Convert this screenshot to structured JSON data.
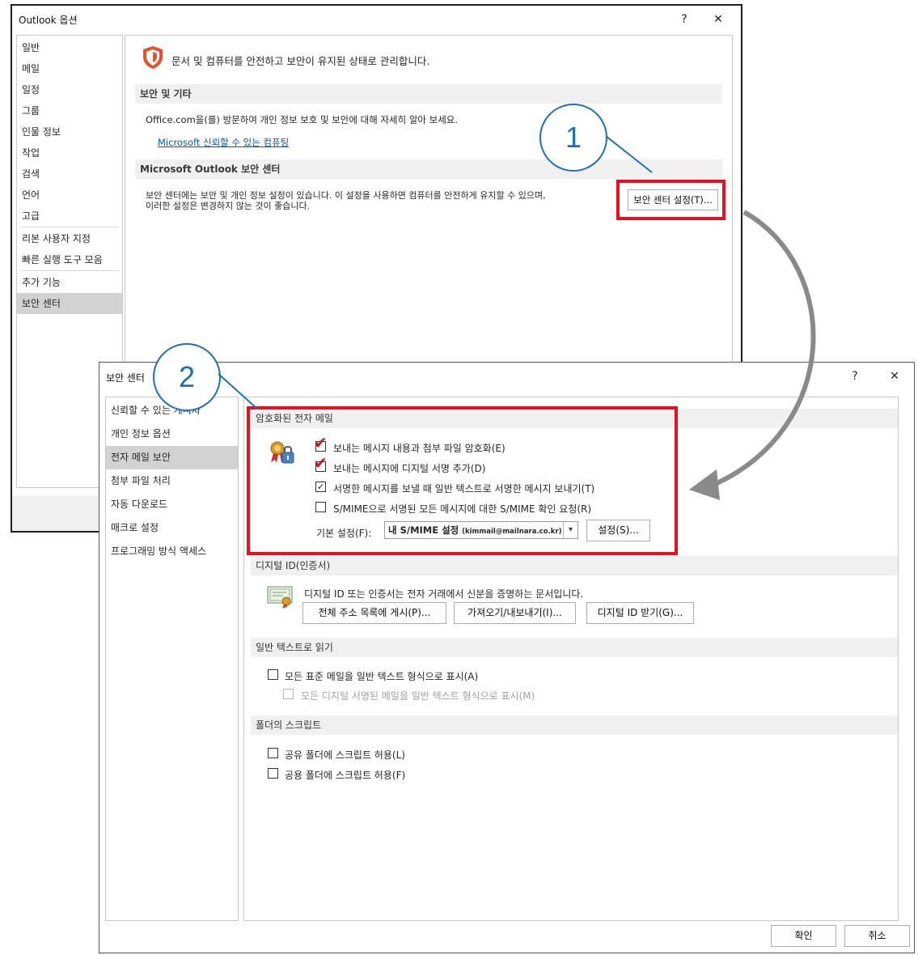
{
  "outlook_options": {
    "title": "Outlook 옵션",
    "help": "?",
    "close": "✕",
    "nav": [
      "일반",
      "메일",
      "일정",
      "그룹",
      "인물 정보",
      "작업",
      "검색",
      "언어",
      "고급",
      "리본 사용자 지정",
      "빠른 실행 도구 모음",
      "추가 기능",
      "보안 센터"
    ],
    "selected_nav": "보안 센터",
    "header_text": "문서 및 컴퓨터를 안전하고 보안이 유지된 상태로 관리합니다.",
    "section_privacy": "보안 및 기타",
    "privacy_text": "Office.com을(를) 방문하여 개인 정보 보호 및 보안에 대해 자세히 알아 보세요.",
    "privacy_link": "Microsoft 신뢰할 수 있는 컴퓨팅",
    "section_trust": "Microsoft Outlook 보안 센터",
    "trust_text_1": "보안 센터에는 보안 및 개인 정보 설정이 있습니다. 이 설정을 사용하면 컴퓨터를 안전하게 유지할 수 있으며,",
    "trust_text_2": "이러한 설정은 변경하지 않는 것이 좋습니다.",
    "trust_button": "보안 센터 설정(T)..."
  },
  "trust_center": {
    "title": "보안 센터",
    "help": "?",
    "close": "✕",
    "nav": [
      "신뢰할 수 있는 게시자",
      "개인 정보 옵션",
      "전자 메일 보안",
      "첨부 파일 처리",
      "자동 다운로드",
      "매크로 설정",
      "프로그래밍 방식 액세스"
    ],
    "selected_nav": "전자 메일 보안",
    "encrypted": {
      "heading": "암호화된 전자 메일",
      "options": [
        {
          "label": "보내는 메시지 내용과 첨부 파일 암호화(E)",
          "checked": true
        },
        {
          "label": "보내는 메시지에 디지털 서명 추가(D)",
          "checked": true
        },
        {
          "label": "서명한 메시지를 보낼 때 일반 텍스트로 서명한 메시지 보내기(T)",
          "checked": true
        },
        {
          "label": "S/MIME으로 서명된 모든 메시지에 대한 S/MIME 확인 요청(R)",
          "checked": false
        }
      ],
      "default_label": "기본 설정(F):",
      "default_value": "내 S/MIME 설정",
      "default_email": "(kimmail@mailnara.co.kr)",
      "settings_button": "설정(S)..."
    },
    "digital_id": {
      "heading": "디지털 ID(인증서)",
      "text": "디지털 ID 또는 인증서는 전자 거래에서 신분을 증명하는 문서입니다.",
      "buttons": [
        "전체 주소 목록에 게시(P)...",
        "가져오기/내보내기(I)...",
        "디지털 ID 받기(G)..."
      ]
    },
    "plain_text": {
      "heading": "일반 텍스트로 읽기",
      "opt1": "모든 표준 메일을 일반 텍스트 형식으로 표시(A)",
      "opt2": "모든 디지털 서명된 메일을 일반 텍스트 형식으로 표시(M)"
    },
    "folder_script": {
      "heading": "폴더의 스크립트",
      "opt1": "공유 폴더에 스크립트 허용(L)",
      "opt2": "공용 폴더에 스크립트 허용(F)"
    },
    "ok": "확인",
    "cancel": "취소"
  },
  "callouts": {
    "one": "1",
    "two": "2"
  },
  "colors": {
    "highlight": "#e8101e",
    "callout": "#1f6fb8",
    "link": "#0b57b3"
  }
}
